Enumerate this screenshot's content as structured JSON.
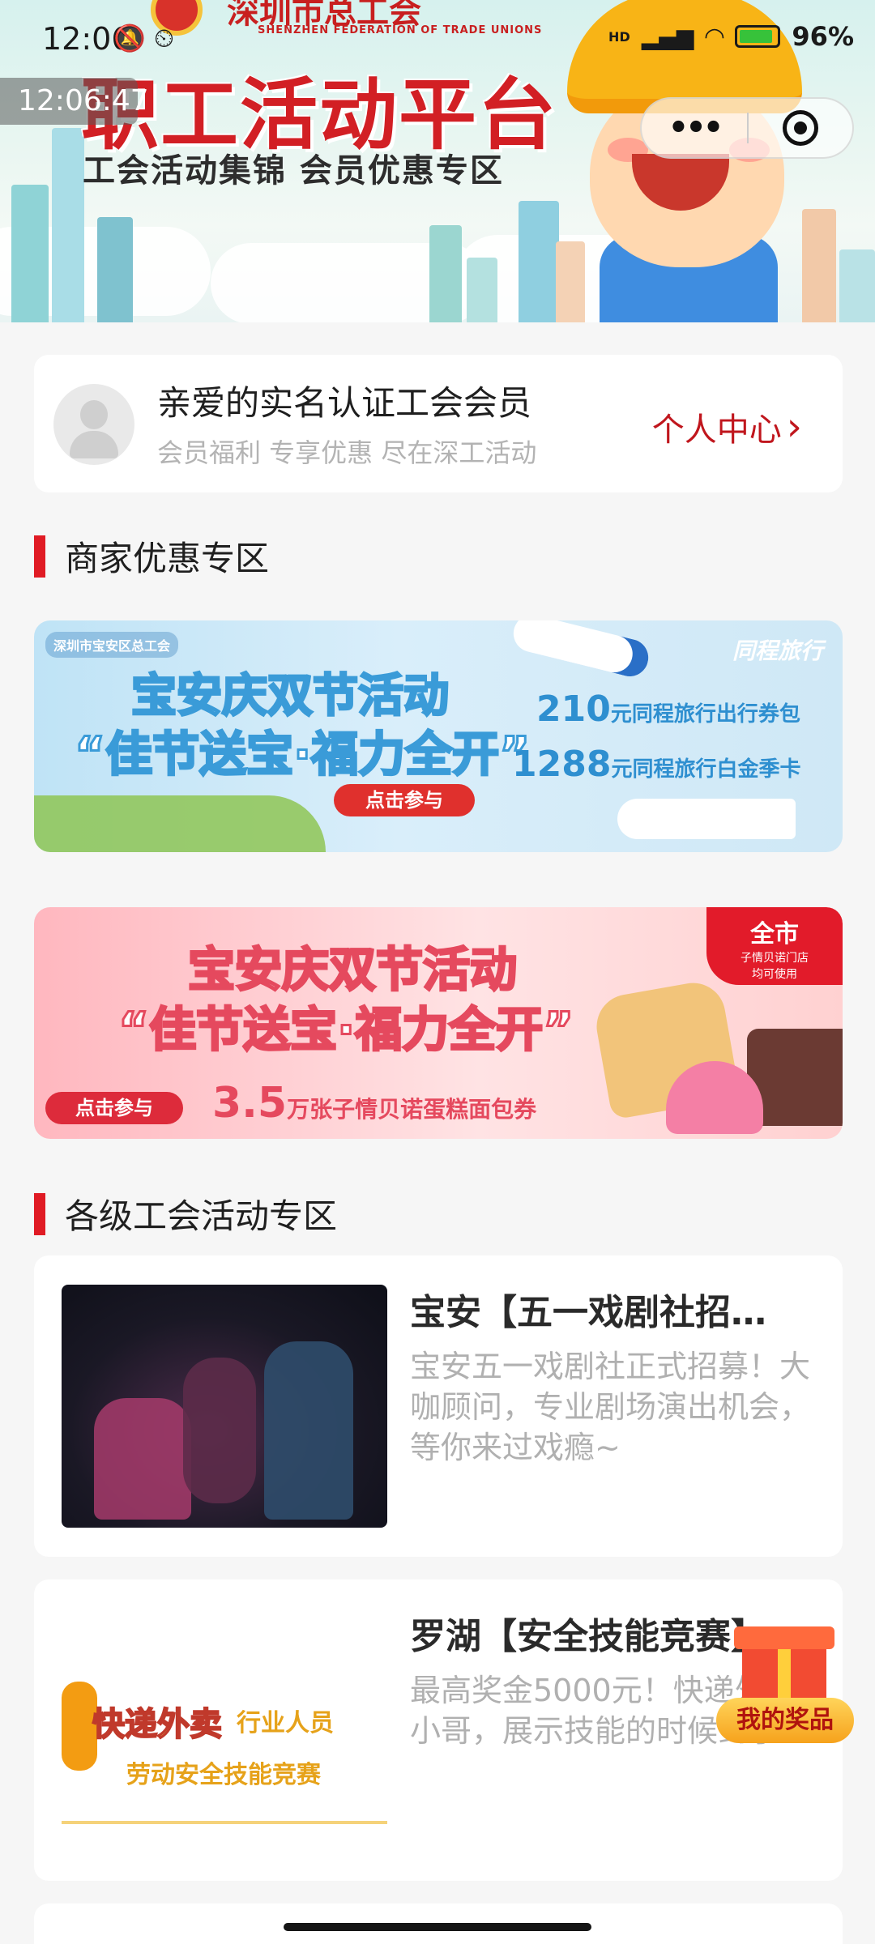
{
  "status_bar": {
    "time": "12:06",
    "status_icons": "🔕 ⏲",
    "network": "HD",
    "battery_percent": "96%",
    "floating_clock": "12:06:47"
  },
  "banner": {
    "org_name": "深圳市总工会",
    "org_name_en": "SHENZHEN FEDERATION OF TRADE UNIONS",
    "title": "职工活动平台",
    "subtitle": "工会活动集锦  会员优惠专区"
  },
  "capsule": {
    "more_icon": "more-dots",
    "close_icon": "target-circle"
  },
  "user_card": {
    "title": "亲爱的实名认证工会会员",
    "subtitle": "会员福利 专享优惠 尽在深工活动",
    "link": "个人中心",
    "link_chevron": "›"
  },
  "sections": {
    "merchant": "商家优惠专区",
    "activities": "各级工会活动专区"
  },
  "promos": [
    {
      "org": "深圳市宝安区总工会",
      "brand": "同程旅行",
      "headline1": "宝安庆双节活动",
      "headline2": "“佳节送宝·福力全开”",
      "button": "点击参与",
      "prize1_num": "210",
      "prize1_text": "元同程旅行出行券包",
      "prize2_num": "1288",
      "prize2_text": "元同程旅行白金季卡"
    },
    {
      "badge_main": "全市",
      "badge_sub1": "子情贝诺门店",
      "badge_sub2": "均可使用",
      "headline1": "宝安庆双节活动",
      "headline2": "“佳节送宝·福力全开”",
      "button": "点击参与",
      "prize_num": "3.5",
      "prize_text": "万张子情贝诺蛋糕面包券"
    }
  ],
  "activities": [
    {
      "title": "宝安【五一戏剧社招…",
      "desc": "宝安五一戏剧社正式招募！大咖顾问，专业剧场演出机会，等你来过戏瘾~"
    },
    {
      "title": "罗湖【安全技能竞赛】",
      "desc": "最高奖金5000元！快递外卖小哥，展示技能的时候到了！",
      "img_badge": "快递外卖",
      "img_line1": "行业人员",
      "img_line2": "劳动安全技能竞赛"
    }
  ],
  "floating": {
    "label": "我的奖品"
  }
}
